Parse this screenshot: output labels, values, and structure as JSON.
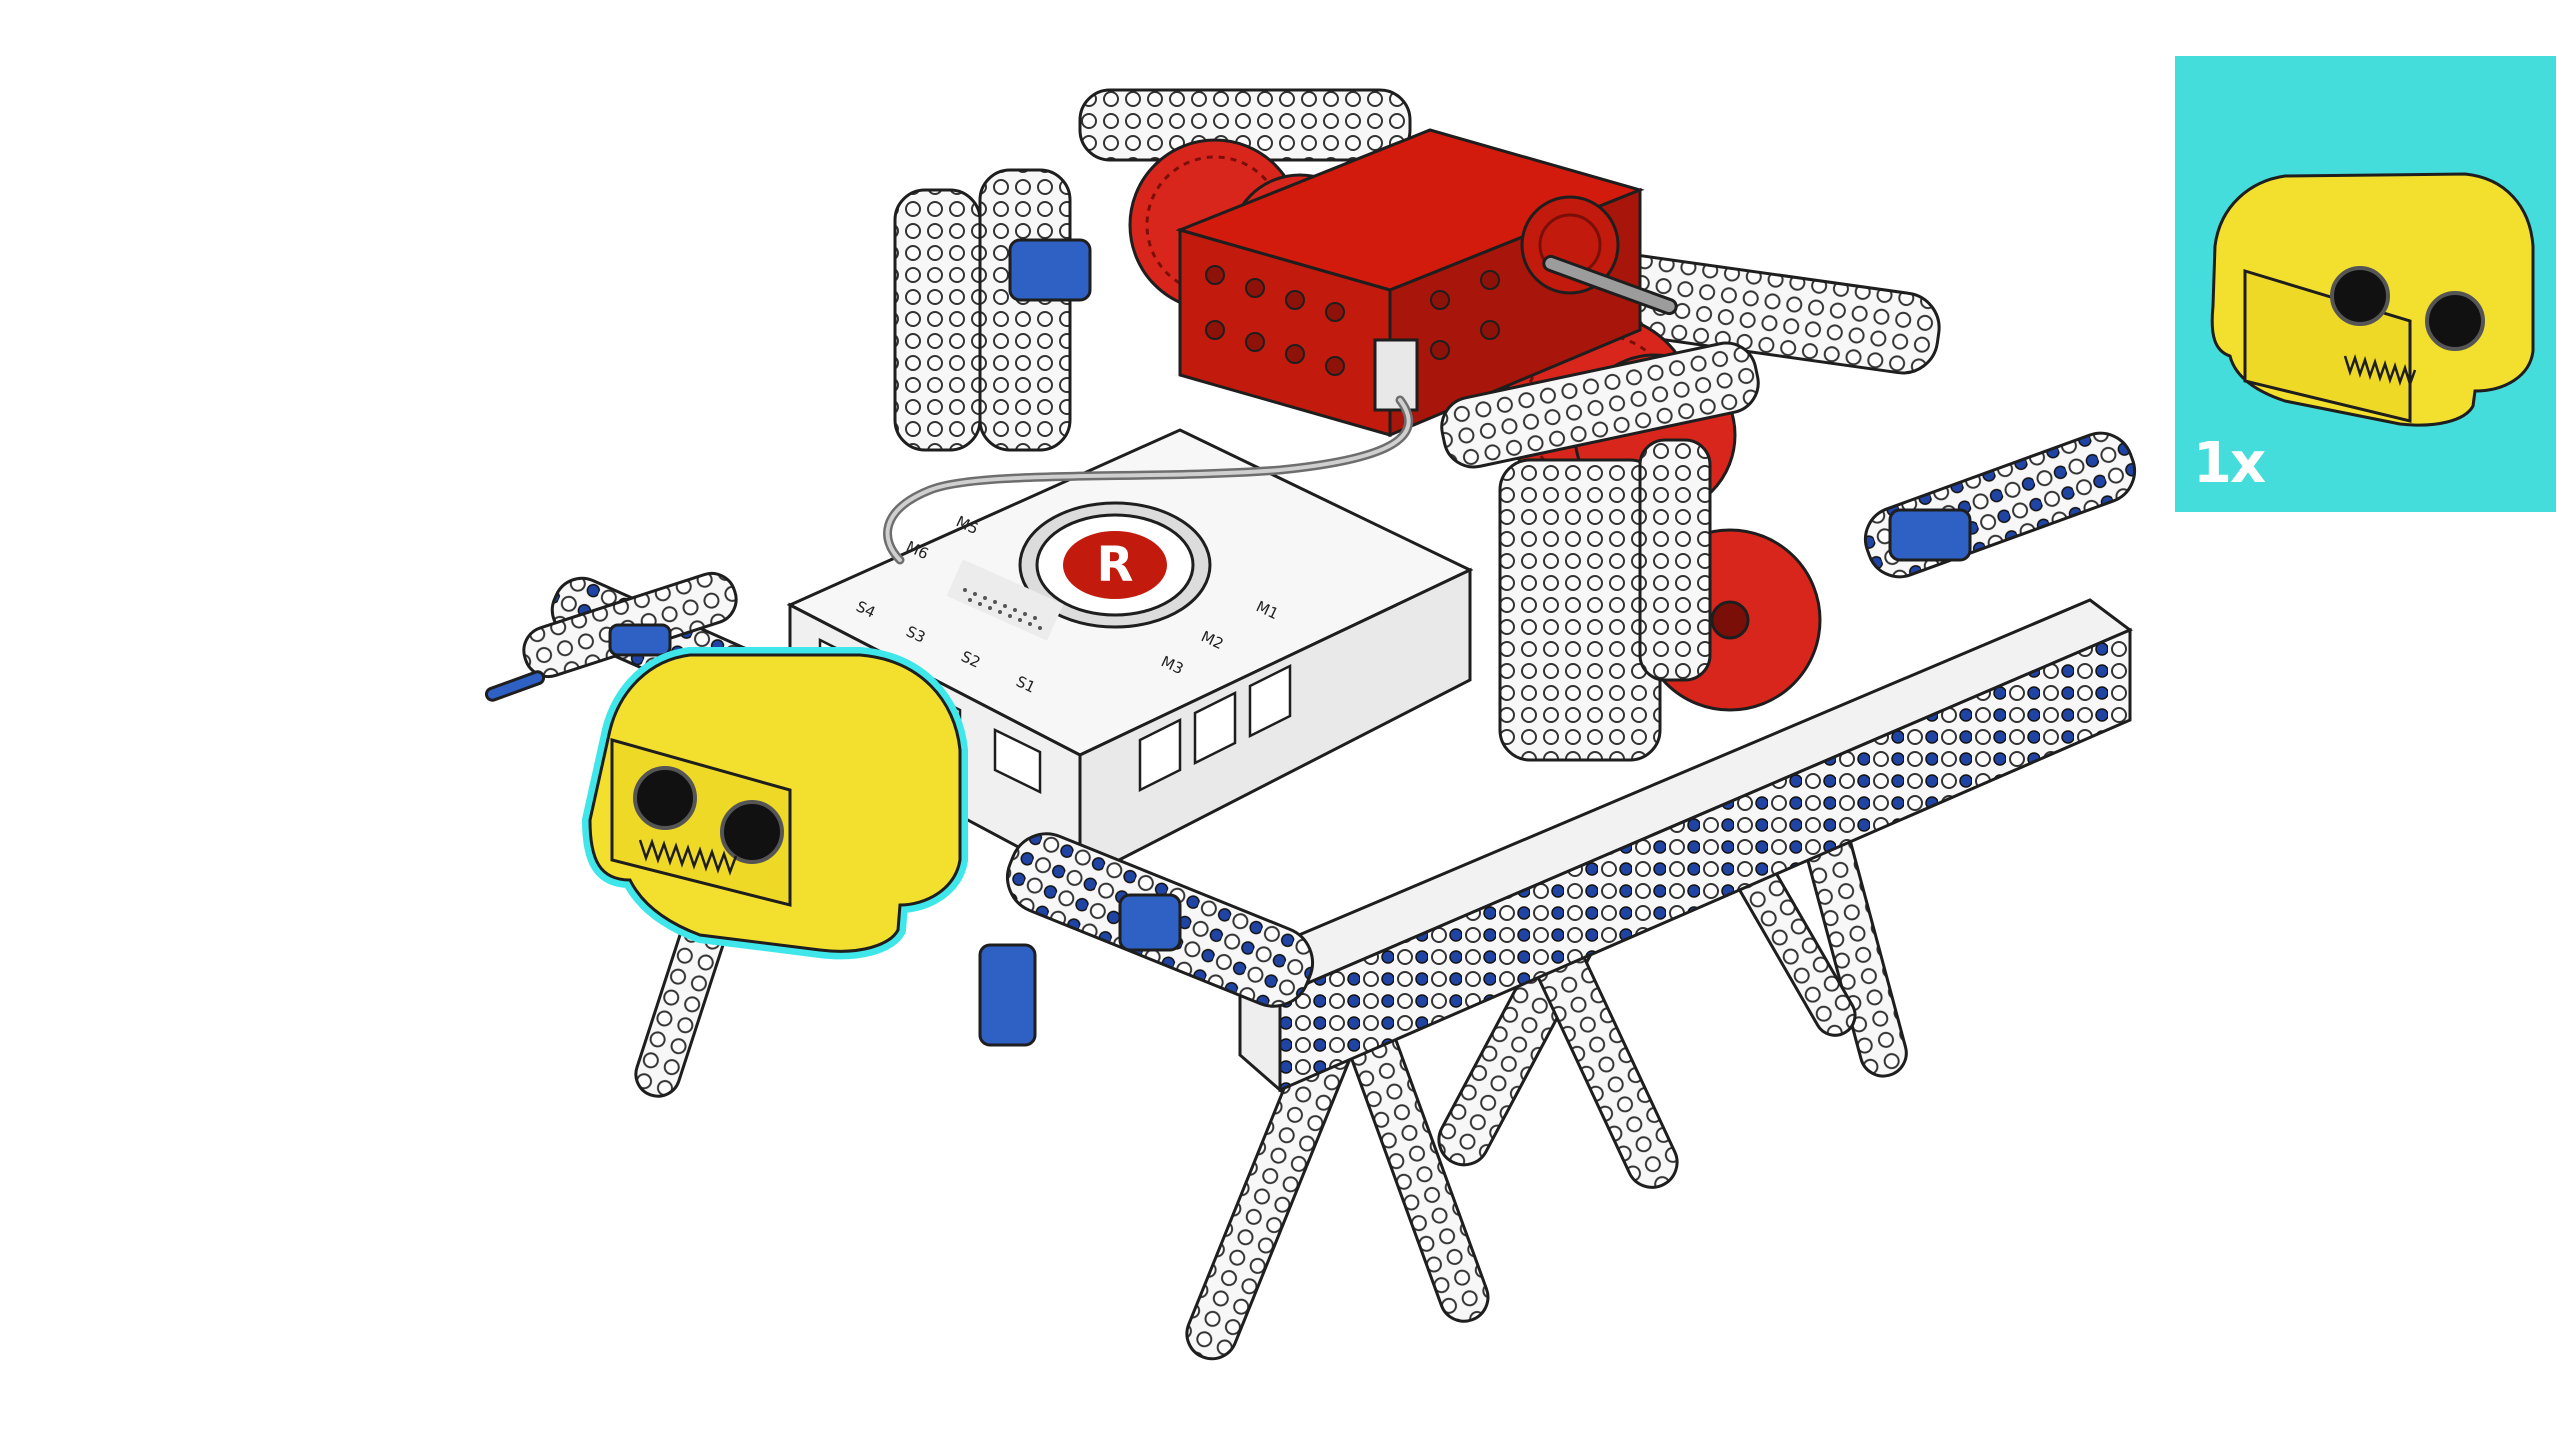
{
  "assembly_step": {
    "new_part": "ultrasonic-distance-sensor",
    "highlight_color": "#3fe6ea"
  },
  "parts_panel": {
    "background": "#45dcdc",
    "quantity_label": "1x",
    "part_icon": "ultrasonic-sensor-icon"
  },
  "controller_labels": {
    "motor_ports": [
      "M1",
      "M2",
      "M3",
      "M5",
      "M6"
    ],
    "sensor_ports": [
      "S1",
      "S2",
      "S3",
      "S4"
    ],
    "logo": "R"
  },
  "colors": {
    "frame_white": "#f7f7f7",
    "outline": "#1e1e1e",
    "motor_red": "#c21a0c",
    "gear_red": "#d8261c",
    "sensor_yellow": "#f3e02e",
    "connector_blue": "#2f60c4",
    "hole_blue": "#1f44a3"
  }
}
